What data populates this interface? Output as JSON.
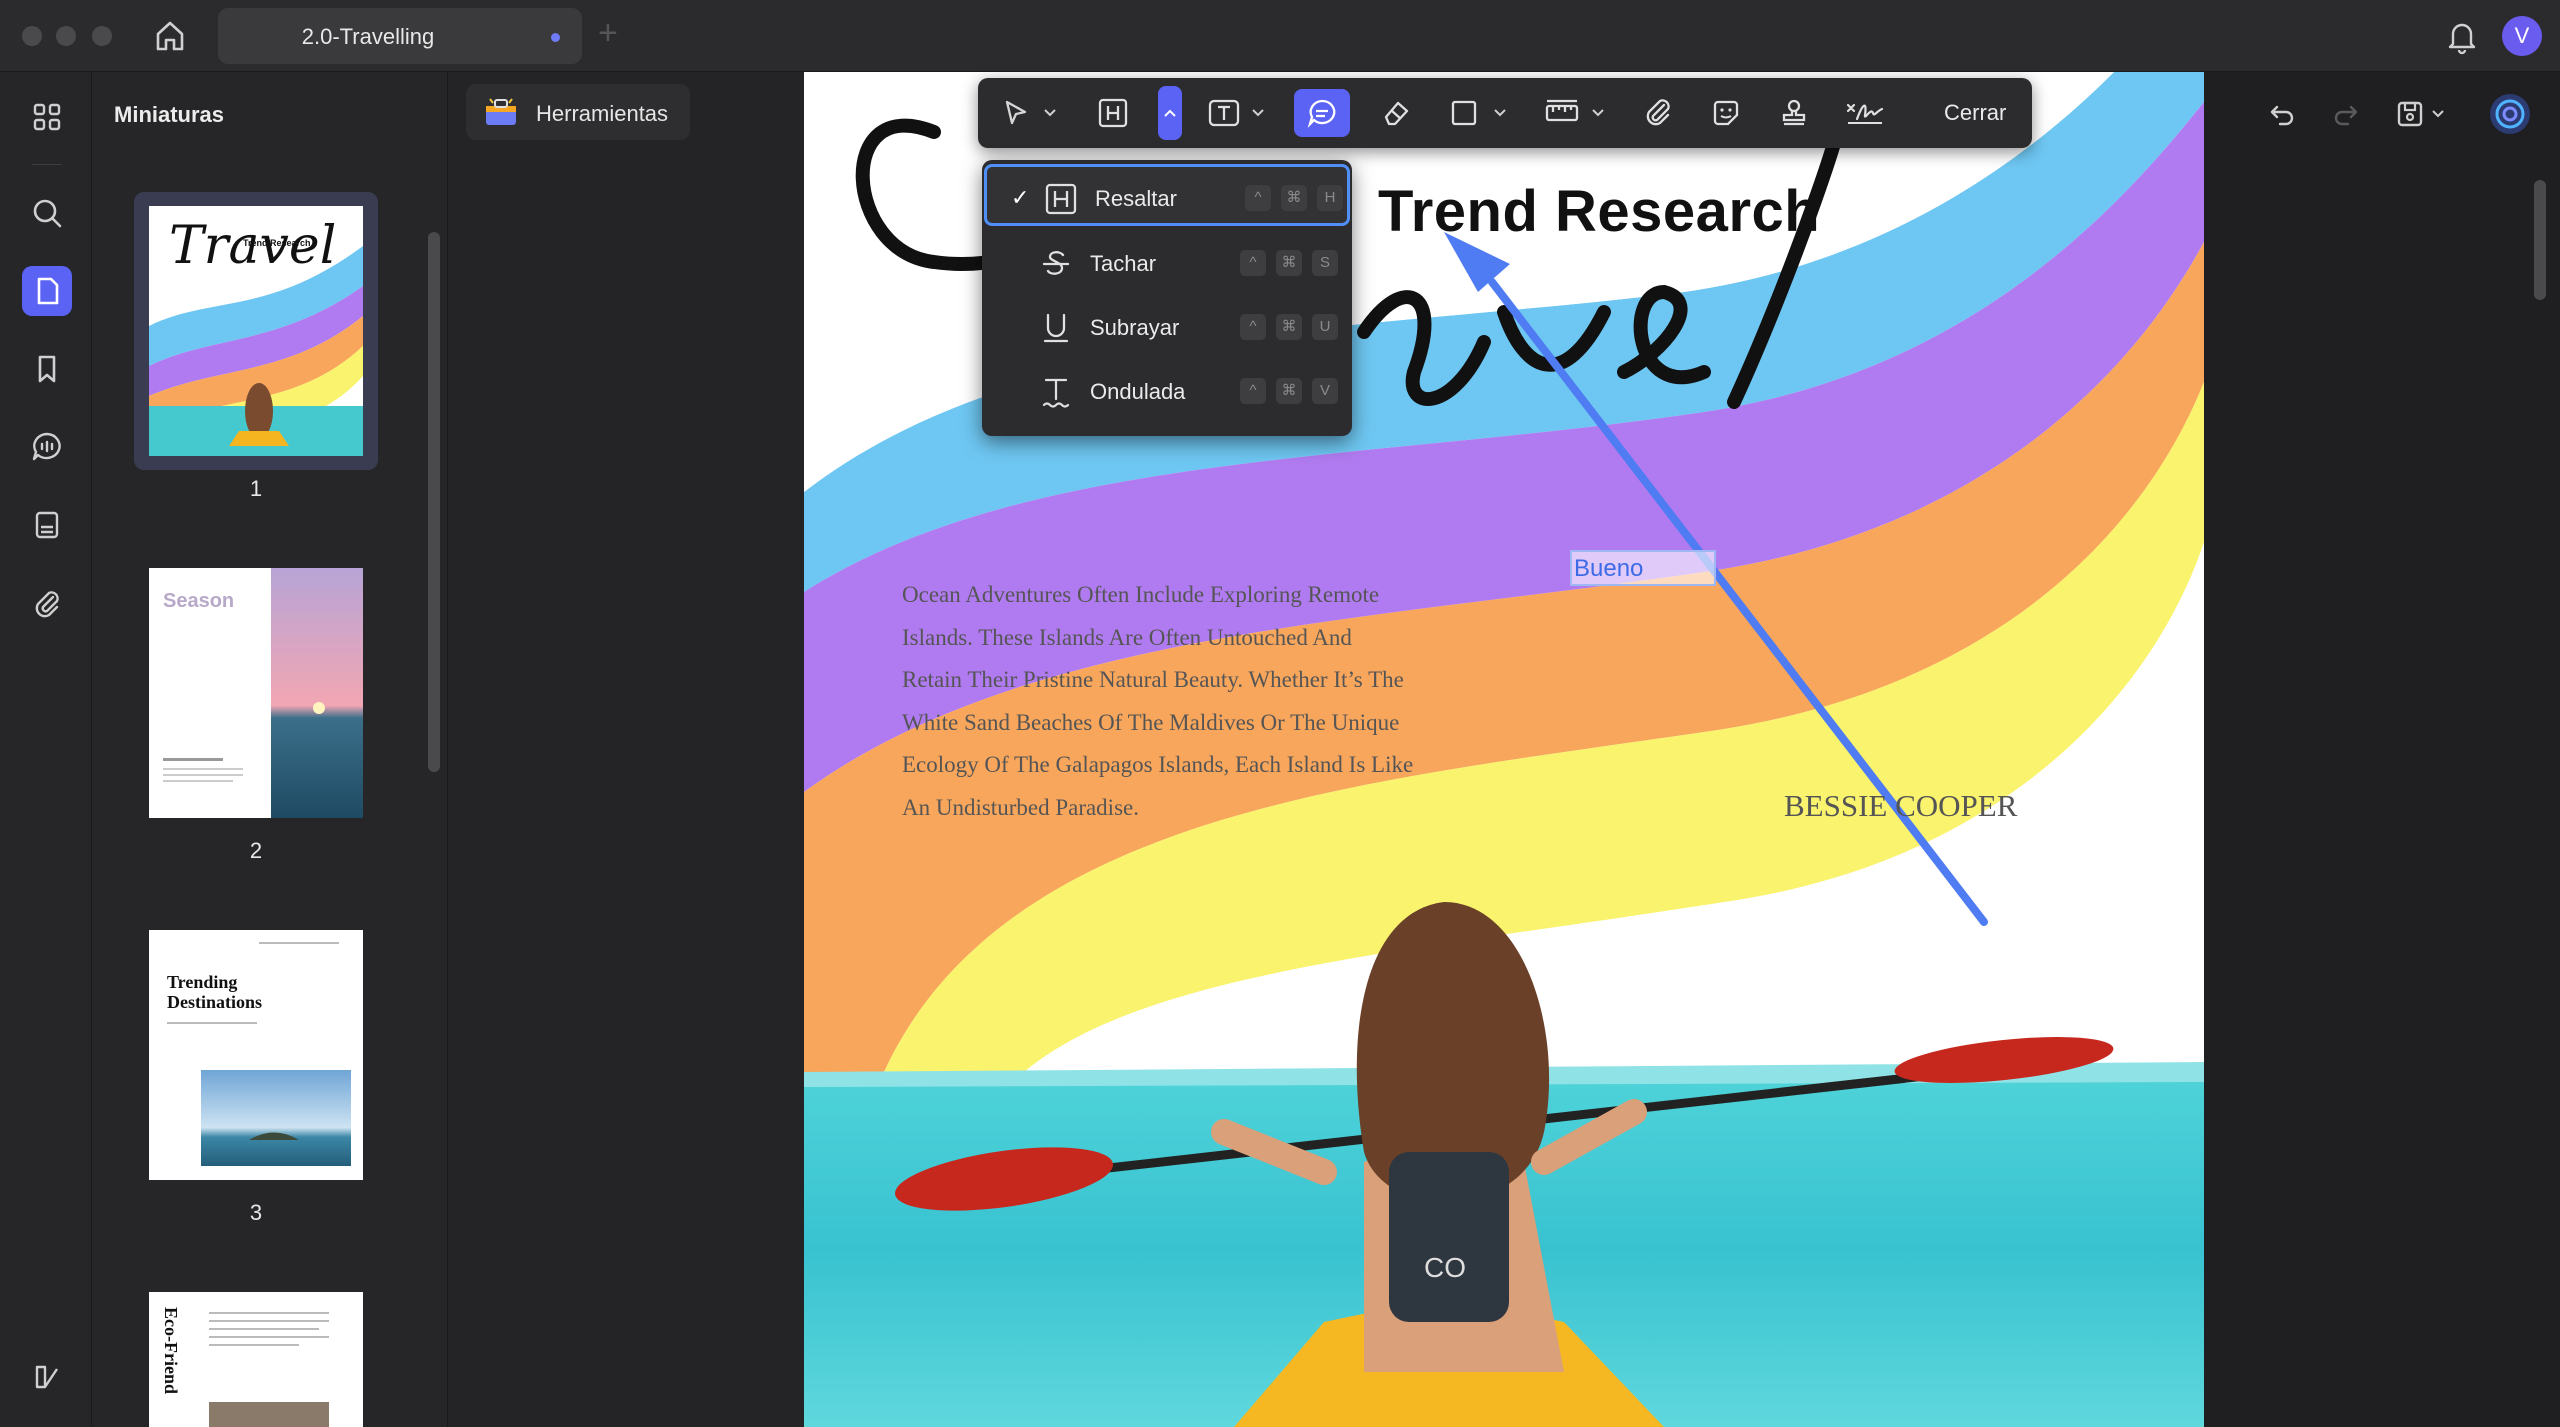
{
  "window": {
    "tab_title": "2.0-Travelling",
    "new_tab": "+",
    "avatar_letter": "V"
  },
  "sidebar_panel": {
    "title": "Miniaturas",
    "thumbnails": [
      {
        "number": "1"
      },
      {
        "number": "2"
      },
      {
        "number": "3"
      }
    ]
  },
  "tools_button": {
    "label": "Herramientas"
  },
  "toolbar": {
    "close_label": "Cerrar"
  },
  "dropdown": {
    "items": [
      {
        "label": "Resaltar",
        "checked": "✓",
        "keys": [
          "^",
          "⌘",
          "H"
        ]
      },
      {
        "label": "Tachar",
        "checked": "",
        "keys": [
          "^",
          "⌘",
          "S"
        ]
      },
      {
        "label": "Subrayar",
        "checked": "",
        "keys": [
          "^",
          "⌘",
          "U"
        ]
      },
      {
        "label": "Ondulada",
        "checked": "",
        "keys": [
          "^",
          "⌘",
          "V"
        ]
      }
    ]
  },
  "document": {
    "trend_title": "Trend Research",
    "script_title": "Travel",
    "body_text": "Ocean Adventures Often Include Exploring Remote Islands. These Islands Are Often Untouched And Retain Their Pristine Natural Beauty. Whether It's The White Sand Beaches Of The Maldives Or The Unique Ecology Of The Galapagos Islands, Each Island Is Like An Undisturbed Paradise.",
    "body_lines": [
      "Ocean Adventures Often Include Exploring Remote",
      "Islands. These Islands Are Often Untouched And",
      "Retain Their Pristine Natural Beauty. Whether It’s The",
      "White Sand Beaches Of The Maldives Or The Unique",
      "Ecology Of The Galapagos Islands, Each Island Is Like",
      "An Undisturbed Paradise."
    ],
    "author": "BESSIE COOPER",
    "annotation_text": "Bueno",
    "kayak_logo": "CO"
  },
  "thumb_texts": {
    "t1_title": "Travel",
    "t1_sub": "Trend Research",
    "t2_title": "Season",
    "t3_title_1": "Trending",
    "t3_title_2": "Destinations",
    "t4_side": "Eco-Friend"
  },
  "colors": {
    "accent": "#5b63f5",
    "select_outline": "#4f8ff7",
    "arrow": "#4f7cf2",
    "rainbow_blue": "#6ec7f2",
    "rainbow_purple": "#b07bf0",
    "rainbow_orange": "#f8a65c",
    "rainbow_yellow": "#f9f36e"
  }
}
